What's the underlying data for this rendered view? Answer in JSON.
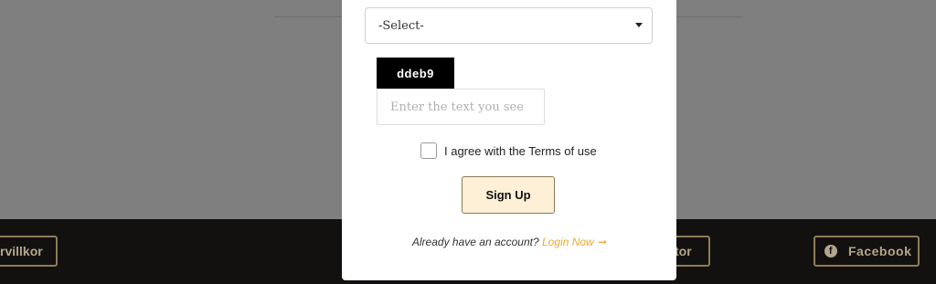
{
  "background": {
    "footer": {
      "terms_button_label": "rvillkor",
      "mid_button_label": "tor",
      "facebook_button_label": "Facebook",
      "facebook_icon": "facebook-icon"
    }
  },
  "modal": {
    "select": {
      "value": "-Select-"
    },
    "captcha": {
      "code": "ddeb9",
      "input_placeholder": "Enter the text you see"
    },
    "terms": {
      "label": "I agree with the Terms of use"
    },
    "signup_label": "Sign Up",
    "login": {
      "prompt": "Already have an account?",
      "link_label": "Login Now",
      "arrow": "➞"
    }
  },
  "colors": {
    "accent": "#f0a830",
    "signup_bg": "#fdf0d6",
    "footer_bg": "#131110"
  }
}
